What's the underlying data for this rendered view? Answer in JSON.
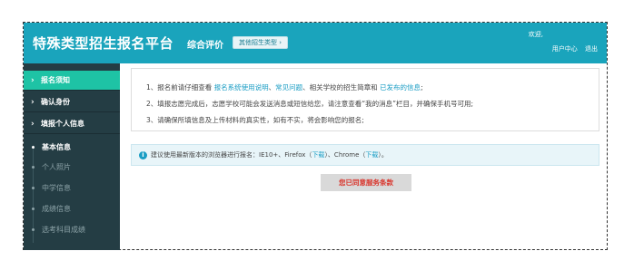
{
  "header": {
    "site_title": "特殊类型招生报名平台",
    "sub_title": "综合评价",
    "other_type_button": "其他招生类型 ›",
    "welcome": "欢迎,",
    "user_center": "用户中心",
    "logout": "退出"
  },
  "sidebar": {
    "nav": [
      {
        "label": "报名须知",
        "icon": "chevron-right-icon",
        "active": true
      },
      {
        "label": "确认身份",
        "icon": "chevron-right-icon",
        "active": false
      },
      {
        "label": "填报个人信息",
        "icon": "chevron-right-icon",
        "active": false
      }
    ],
    "sub_items": [
      {
        "label": "基本信息",
        "active": true
      },
      {
        "label": "个人照片",
        "active": false
      },
      {
        "label": "中学信息",
        "active": false
      },
      {
        "label": "成绩信息",
        "active": false
      },
      {
        "label": "选考科目成绩",
        "active": false
      }
    ]
  },
  "notice": {
    "line1_prefix": "1、报名前请仔细查看",
    "line1_link1": "报名系统使用说明",
    "line1_sep": "、",
    "line1_link2": "常见问题",
    "line1_mid": "、相关学校的招生简章和",
    "line1_link3": "已发布的信息",
    "line1_end": ";",
    "line2": "2、填报志愿完成后，志愿学校可能会发送消息或短信给您，请注意查看“我的消息”栏目，并确保手机号可用;",
    "line3": "3、请确保所填信息及上传材料的真实性，如有不实，将会影响您的报名;"
  },
  "tip": {
    "icon": "info-icon",
    "text_prefix": "建议使用最新版本的浏览器进行报名：IE10+、Firefox（",
    "link1": "下载",
    "text_mid": "）、Chrome（",
    "link2": "下载",
    "text_end": "）。"
  },
  "agree_button": "您已同意服务条款",
  "colors": {
    "header_bg": "#1aa4bc",
    "sidebar_bg": "#243d44",
    "active_nav": "#1ec3a5",
    "link": "#1a9dc4",
    "agree_text": "#d9342b"
  }
}
